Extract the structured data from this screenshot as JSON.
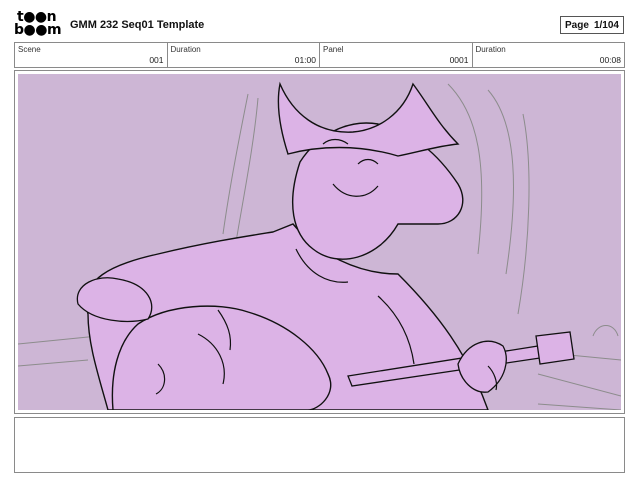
{
  "brand": {
    "logo_line1": "t●●n",
    "logo_line2": "b●●m"
  },
  "header": {
    "title": "GMM 232 Seq01 Template"
  },
  "page": {
    "label": "Page",
    "value": "1/104"
  },
  "info": [
    {
      "label": "Scene",
      "value": "001"
    },
    {
      "label": "Duration",
      "value": "01:00"
    },
    {
      "label": "Panel",
      "value": "0001"
    },
    {
      "label": "Duration",
      "value": "00:08"
    }
  ],
  "panel": {
    "background_color": "#cdb6d5",
    "figure_color": "#dcb3e6",
    "line_color": "#111111"
  },
  "notes": {
    "text": ""
  }
}
